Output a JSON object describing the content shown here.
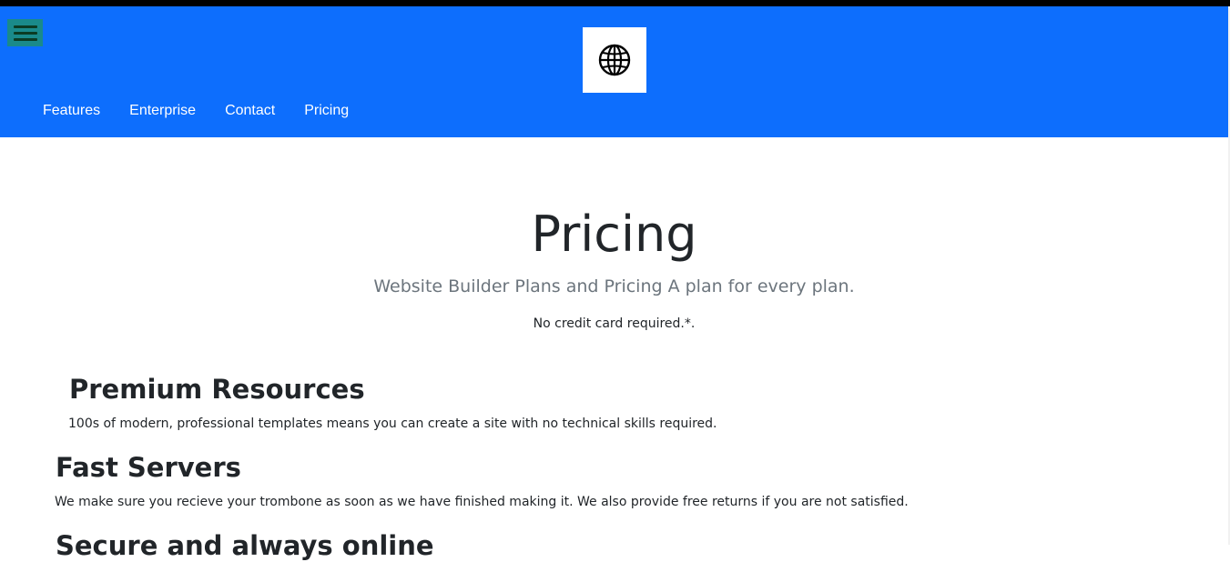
{
  "header": {
    "logo_icon": "globe-icon",
    "menu_icon": "hamburger-menu-icon",
    "colors": {
      "background": "#0d6efd",
      "menu_button": "#1a8a8a"
    },
    "nav": [
      "Features",
      "Enterprise",
      "Contact",
      "Pricing"
    ]
  },
  "main": {
    "title": "Pricing",
    "subtitle": "Website Builder Plans and Pricing A plan for every plan.",
    "note": "No credit card required.*.",
    "features": [
      {
        "heading": "Premium Resources",
        "text": "100s of modern, professional templates means you can create a site with no technical skills required."
      },
      {
        "heading": "Fast Servers",
        "text": "We make sure you recieve your trombone as soon as we have finished making it. We also provide free returns if you are not satisfied."
      },
      {
        "heading": "Secure and always online",
        "text": ""
      }
    ]
  }
}
